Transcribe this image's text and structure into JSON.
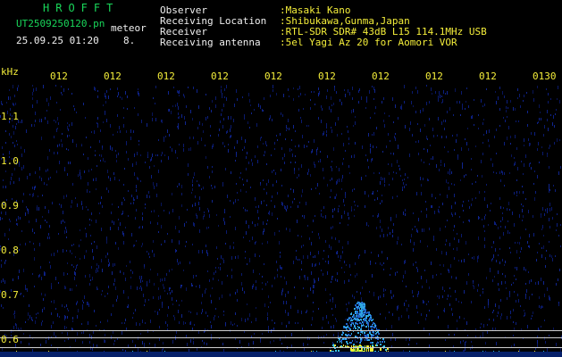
{
  "header": {
    "brand": "HROFFT",
    "filename": "UT2509250120.pn",
    "tag": "meteor",
    "datetime": "25.09.25 01:20",
    "count": "8.",
    "info": [
      {
        "label": "Observer",
        "value": ":Masaki Kano"
      },
      {
        "label": "Receiving Location",
        "value": ":Shibukawa,Gunma,Japan"
      },
      {
        "label": "Receiver",
        "value": ":RTL-SDR SDR# 43dB L15 114.1MHz USB"
      },
      {
        "label": "Receiving antenna",
        "value": ":5el Yagi Az 20 for Aomori VOR"
      }
    ]
  },
  "axis": {
    "unit": "kHz",
    "x_ticks": [
      "012",
      "012",
      "012",
      "012",
      "012",
      "012",
      "012",
      "012",
      "012",
      "0130"
    ],
    "y_ticks": [
      "1.1",
      "1.0",
      "0.9",
      "0.8",
      "0.7",
      "0.6"
    ]
  },
  "colors": {
    "background": "#000000",
    "header_green": "#19d65a",
    "axis_yellow": "#f4ee3a",
    "waterfall_noise": "#0b1560",
    "signal_cyan": "#2fb7e6",
    "signal_yellow": "#e8e534"
  }
}
